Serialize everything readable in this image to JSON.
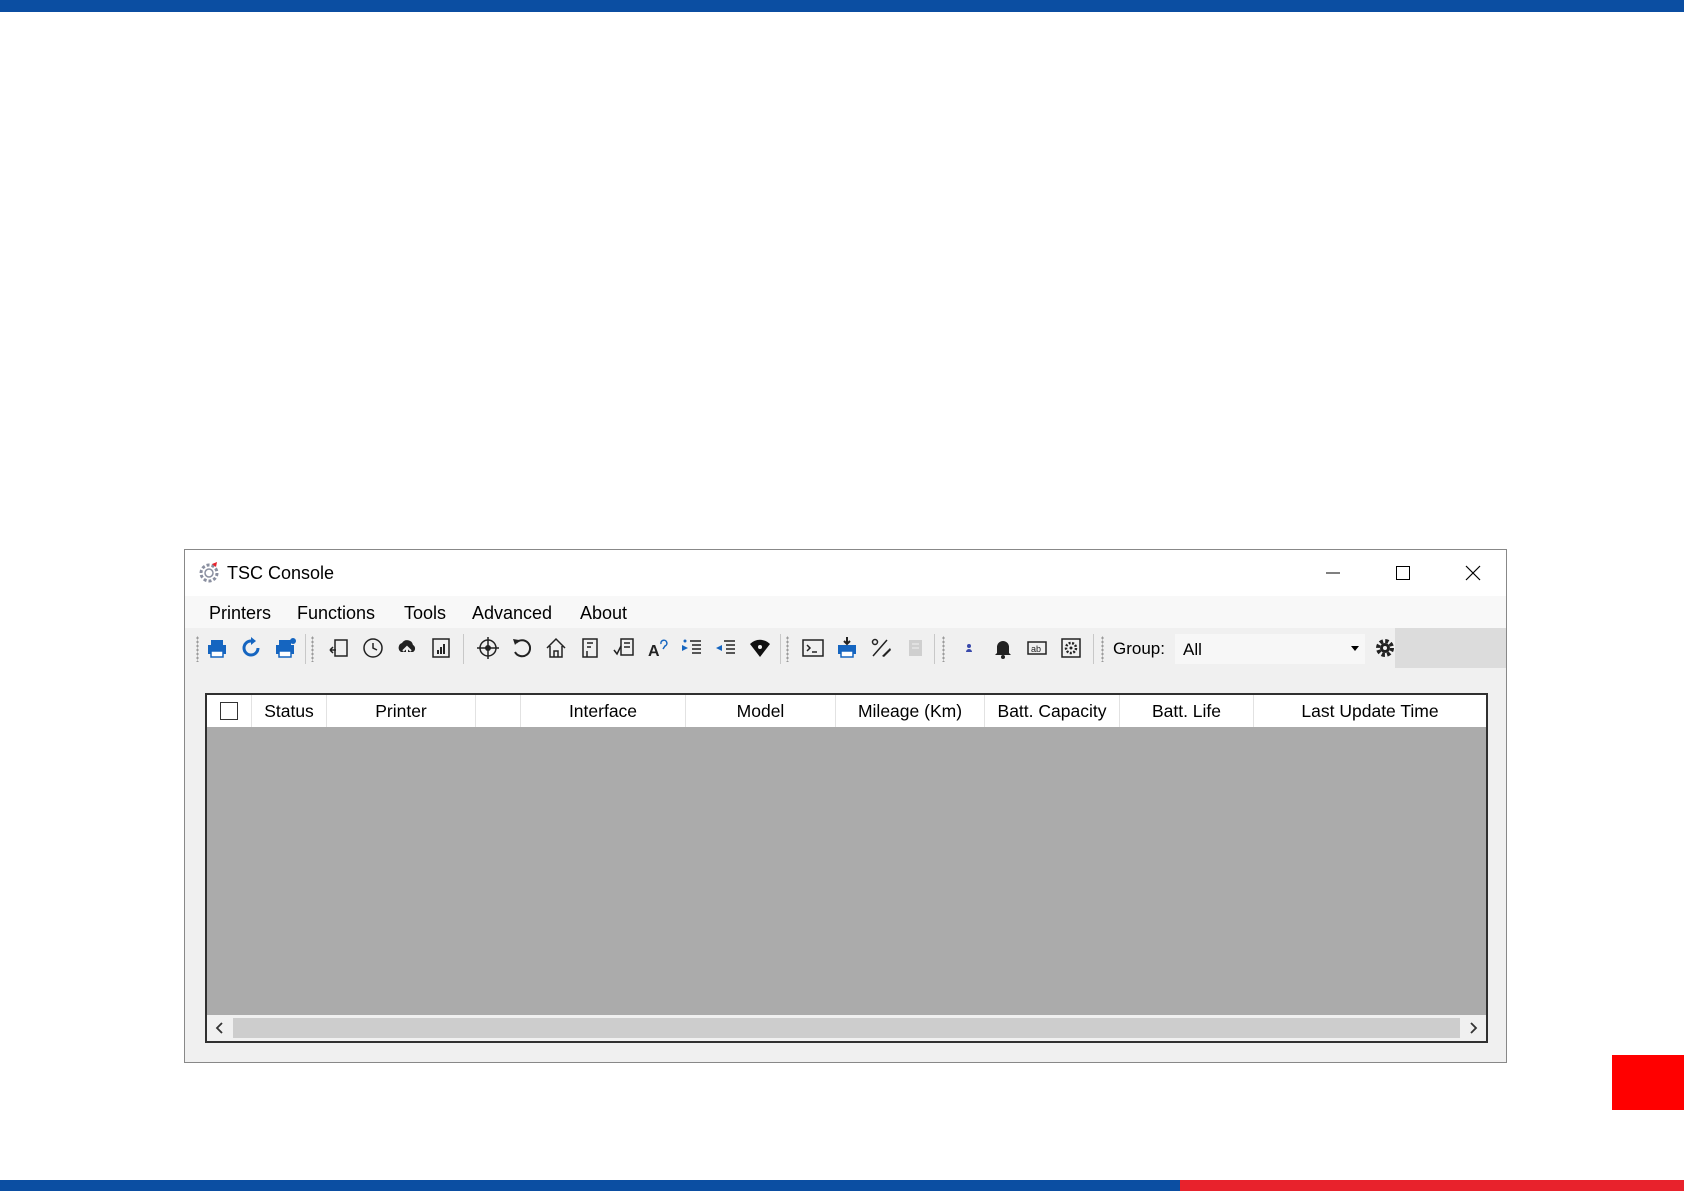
{
  "window": {
    "title": "TSC Console"
  },
  "menu": [
    "Printers",
    "Functions",
    "Tools",
    "Advanced",
    "About"
  ],
  "toolbar": {
    "group_label": "Group:",
    "group_value": "All"
  },
  "grid": {
    "columns": [
      "Status",
      "Printer",
      "",
      "Interface",
      "Model",
      "Mileage (Km)",
      "Batt. Capacity",
      "Batt. Life",
      "Last Update Time"
    ]
  },
  "colors": {
    "brand_blue": "#0b4ea2",
    "brand_red": "#e8222c",
    "tab_red": "#ff0000",
    "toolbar_icon_blue": "#1565c0"
  }
}
